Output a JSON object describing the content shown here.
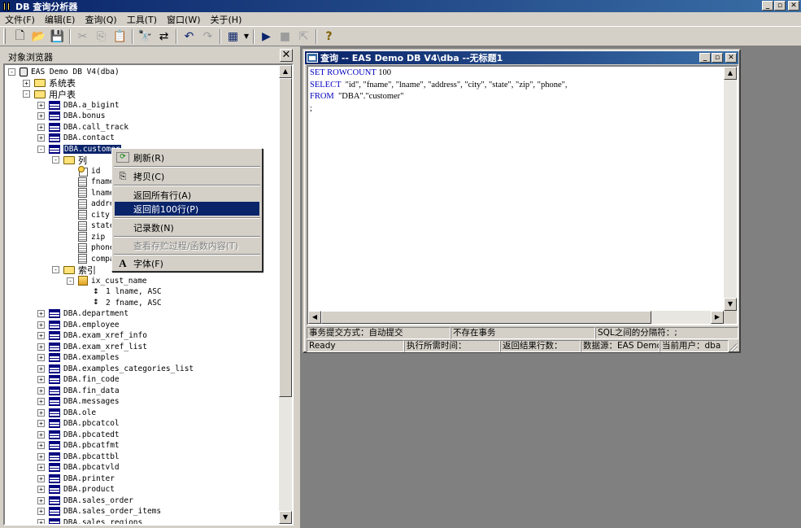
{
  "app": {
    "title": "DB 查询分析器",
    "win_min": "_",
    "win_max": "▫",
    "win_close": "✕"
  },
  "menu": [
    "文件(F)",
    "编辑(E)",
    "查询(Q)",
    "工具(T)",
    "窗口(W)",
    "关于(H)"
  ],
  "toolbar": {
    "buttons": [
      {
        "name": "new-icon",
        "glyph": "🗋",
        "enabled": true
      },
      {
        "name": "open-icon",
        "glyph": "📂",
        "enabled": true
      },
      {
        "name": "save-icon",
        "glyph": "💾",
        "enabled": true
      },
      {
        "name": "cut-icon",
        "glyph": "✂",
        "enabled": false
      },
      {
        "name": "copy-icon",
        "glyph": "⎘",
        "enabled": false
      },
      {
        "name": "paste-icon",
        "glyph": "📋",
        "enabled": true
      },
      {
        "name": "find-icon",
        "glyph": "🔭",
        "enabled": true
      },
      {
        "name": "replace-icon",
        "glyph": "⇄",
        "enabled": true
      },
      {
        "name": "undo-icon",
        "glyph": "↶",
        "enabled": true
      },
      {
        "name": "redo-icon",
        "glyph": "↷",
        "enabled": false
      },
      {
        "name": "grid-icon",
        "glyph": "▦",
        "enabled": true
      },
      {
        "name": "run-icon",
        "glyph": "▶",
        "enabled": true
      },
      {
        "name": "stop-icon",
        "glyph": "■",
        "enabled": false
      },
      {
        "name": "export-icon",
        "glyph": "⇱",
        "enabled": false
      },
      {
        "name": "help-icon",
        "glyph": "?",
        "enabled": true
      }
    ]
  },
  "object_browser": {
    "title": "对象浏览器",
    "close": "✕",
    "tree": [
      {
        "label": "EAS Demo DB V4(dba)",
        "kind": "db",
        "exp": "-"
      },
      {
        "label": "系统表",
        "kind": "folder",
        "exp": "+",
        "cjk": true
      },
      {
        "label": "用户表",
        "kind": "folder",
        "exp": "-",
        "cjk": true
      },
      {
        "label": "DBA.a_bigint",
        "kind": "table",
        "exp": "+"
      },
      {
        "label": "DBA.bonus",
        "kind": "table",
        "exp": "+"
      },
      {
        "label": "DBA.call_track",
        "kind": "table",
        "exp": "+"
      },
      {
        "label": "DBA.contact",
        "kind": "table",
        "exp": "+"
      },
      {
        "label": "DBA.customer",
        "kind": "table",
        "exp": "-",
        "selected": true
      },
      {
        "label": "列",
        "kind": "folder",
        "exp": "-",
        "cjk": true
      },
      {
        "label": "id",
        "kind": "key"
      },
      {
        "label": "fname",
        "kind": "column"
      },
      {
        "label": "lname",
        "kind": "column"
      },
      {
        "label": "address",
        "kind": "column"
      },
      {
        "label": "city",
        "kind": "column"
      },
      {
        "label": "state",
        "kind": "column"
      },
      {
        "label": "zip",
        "kind": "column"
      },
      {
        "label": "phone",
        "kind": "column"
      },
      {
        "label": "company_name",
        "kind": "column"
      },
      {
        "label": "索引",
        "kind": "folder",
        "exp": "-",
        "cjk": true
      },
      {
        "label": "ix_cust_name",
        "kind": "index",
        "exp": "-"
      },
      {
        "label": "1  lname, ASC",
        "kind": "idxcol"
      },
      {
        "label": "2  fname, ASC",
        "kind": "idxcol"
      },
      {
        "label": "DBA.department",
        "kind": "table",
        "exp": "+"
      },
      {
        "label": "DBA.employee",
        "kind": "table",
        "exp": "+"
      },
      {
        "label": "DBA.exam_xref_info",
        "kind": "table",
        "exp": "+"
      },
      {
        "label": "DBA.exam_xref_list",
        "kind": "table",
        "exp": "+"
      },
      {
        "label": "DBA.examples",
        "kind": "table",
        "exp": "+"
      },
      {
        "label": "DBA.examples_categories_list",
        "kind": "table",
        "exp": "+"
      },
      {
        "label": "DBA.fin_code",
        "kind": "table",
        "exp": "+"
      },
      {
        "label": "DBA.fin_data",
        "kind": "table",
        "exp": "+"
      },
      {
        "label": "DBA.messages",
        "kind": "table",
        "exp": "+"
      },
      {
        "label": "DBA.ole",
        "kind": "table",
        "exp": "+"
      },
      {
        "label": "DBA.pbcatcol",
        "kind": "table",
        "exp": "+"
      },
      {
        "label": "DBA.pbcatedt",
        "kind": "table",
        "exp": "+"
      },
      {
        "label": "DBA.pbcatfmt",
        "kind": "table",
        "exp": "+"
      },
      {
        "label": "DBA.pbcattbl",
        "kind": "table",
        "exp": "+"
      },
      {
        "label": "DBA.pbcatvld",
        "kind": "table",
        "exp": "+"
      },
      {
        "label": "DBA.printer",
        "kind": "table",
        "exp": "+"
      },
      {
        "label": "DBA.product",
        "kind": "table",
        "exp": "+"
      },
      {
        "label": "DBA.sales_order",
        "kind": "table",
        "exp": "+"
      },
      {
        "label": "DBA.sales_order_items",
        "kind": "table",
        "exp": "+"
      },
      {
        "label": "DBA.sales_regions",
        "kind": "table",
        "exp": "+"
      }
    ]
  },
  "context_menu": {
    "refresh": {
      "label": "刷新(R)",
      "icon": "refresh-icon"
    },
    "copy": {
      "label": "拷贝(C)",
      "icon": "copy-icon"
    },
    "all_rows": {
      "label": "返回所有行(A)"
    },
    "top100": {
      "label": "返回前100行(P)"
    },
    "count": {
      "label": "记录数(N)"
    },
    "view_source": {
      "label": "查看存贮过程/函数内容(T)"
    },
    "font": {
      "label": "字体(F)",
      "icon": "font-icon",
      "glyph": "A"
    }
  },
  "query_window": {
    "title": "查询 -- EAS Demo DB V4\\dba  --无标题1",
    "code": [
      {
        "kw": "SET ROWCOUNT",
        "rest": " 100"
      },
      {
        "kw": "SELECT",
        "rest": "  \"id\", \"fname\", \"lname\", \"address\", \"city\", \"state\", \"zip\", \"phone\","
      },
      {
        "kw": "FROM",
        "rest": "  \"DBA\".\"customer\""
      },
      {
        "kw": "",
        "rest": ";"
      }
    ],
    "status1": {
      "commit_mode": "事务提交方式：自动提交",
      "txn": "不存在事务",
      "separator": "SQL之间的分隔符：;"
    },
    "status2": {
      "state": "Ready",
      "exec_time": "执行所需时间：",
      "rows": "返回结果行数：",
      "datasource": "数据源：EAS Demo",
      "user": "当前用户：dba"
    }
  }
}
